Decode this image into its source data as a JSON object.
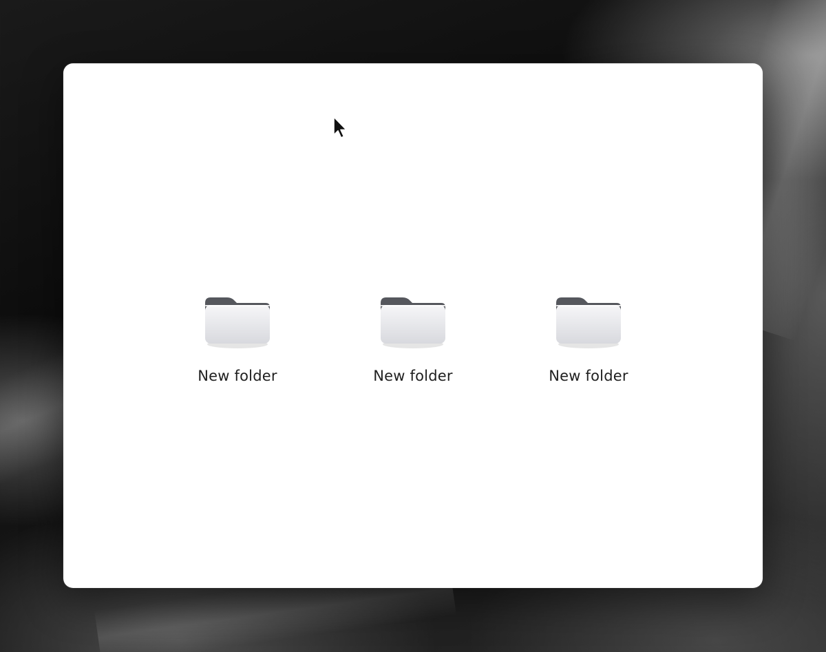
{
  "desktop": {
    "wallpaper": "dark-monochrome-abstract"
  },
  "window": {
    "background_color": "#ffffff"
  },
  "folders": [
    {
      "label": "New folder",
      "icon": "folder-icon"
    },
    {
      "label": "New folder",
      "icon": "folder-icon"
    },
    {
      "label": "New folder",
      "icon": "folder-icon"
    }
  ],
  "colors": {
    "folder_tab": "#55575d",
    "folder_body_top": "#f4f4f6",
    "folder_body_bottom": "#d9dadf",
    "label_text": "#1f1f1f"
  },
  "cursor": {
    "icon": "mouse-pointer-icon"
  }
}
